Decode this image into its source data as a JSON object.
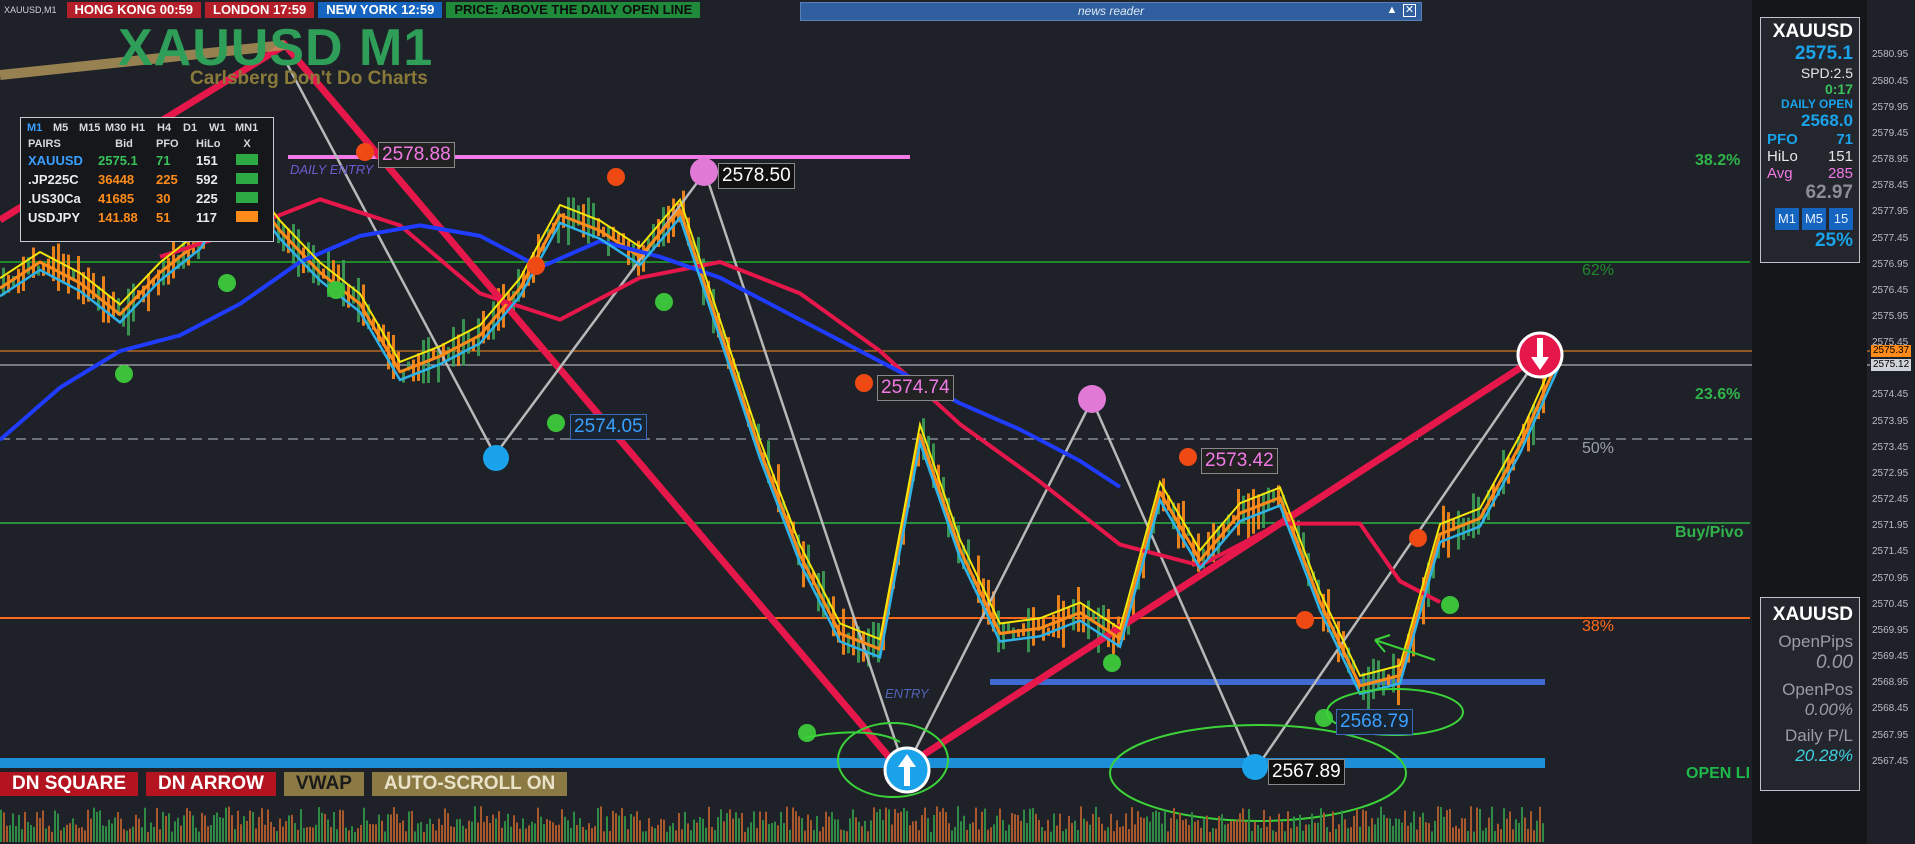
{
  "window": {
    "symbol_tab": "XAUUSD,M1"
  },
  "sessions": [
    {
      "label": "HONG KONG 00:59",
      "color": "#b51f2a"
    },
    {
      "label": "LONDON 17:59",
      "color": "#b51f2a"
    },
    {
      "label": "NEW YORK 12:59",
      "color": "#1565c0"
    },
    {
      "label": "PRICE: ABOVE THE DAILY OPEN LINE",
      "color": "#1e8a3a"
    }
  ],
  "news_reader": {
    "title": "news reader",
    "min_icon": "caret-up-icon",
    "close_icon": "close-icon"
  },
  "header": {
    "title": "XAUUSD M1",
    "subtitle": "Carlsberg Don't Do Charts"
  },
  "pairs_panel": {
    "timeframes": [
      "M1",
      "M5",
      "M15",
      "M30",
      "H1",
      "H4",
      "D1",
      "W1",
      "MN1"
    ],
    "columns": [
      "PAIRS",
      "Bid",
      "PFO",
      "HiLo",
      "X"
    ],
    "rows": [
      {
        "pair": "XAUUSD",
        "bid": "2575.1",
        "pfo": "71",
        "hilo": "151",
        "status_color": "#2eaa44",
        "pair_color": "#3aa0ff",
        "bid_color": "#39c15a"
      },
      {
        "pair": ".JP225C",
        "bid": "36448",
        "pfo": "225",
        "hilo": "592",
        "status_color": "#2eaa44",
        "pair_color": "#ffffff",
        "bid_color": "#ff8c1a"
      },
      {
        "pair": ".US30Ca",
        "bid": "41685",
        "pfo": "30",
        "hilo": "225",
        "status_color": "#2eaa44",
        "pair_color": "#ffffff",
        "bid_color": "#ff8c1a"
      },
      {
        "pair": "USDJPY",
        "bid": "141.88",
        "pfo": "51",
        "hilo": "117",
        "status_color": "#ff8c1a",
        "pair_color": "#ffffff",
        "bid_color": "#ff8c1a"
      }
    ]
  },
  "right_panel": {
    "symbol": "XAUUSD",
    "price": "2575.1",
    "spread": "SPD:2.5",
    "timer": "0:17",
    "daily_open_label": "DAILY OPEN",
    "daily_open": "2568.0",
    "pfo_label": "PFO",
    "pfo": "71",
    "hilo_label": "HiLo",
    "hilo": "151",
    "avg_label": "Avg",
    "avg": "285",
    "value": "62.97",
    "tf_buttons": [
      "M1",
      "M5",
      "15"
    ],
    "percent": "25%"
  },
  "position_panel": {
    "symbol": "XAUUSD",
    "open_pips_label": "OpenPips",
    "open_pips": "0.00",
    "open_pos_label": "OpenPos",
    "open_pos": "0.00%",
    "daily_pl_label": "Daily P/L",
    "daily_pl": "20.28%"
  },
  "bottom_buttons": [
    {
      "label": "DN SQUARE",
      "bg": "#b3141f",
      "fg": "#ffffff"
    },
    {
      "label": "DN ARROW",
      "bg": "#b3141f",
      "fg": "#ffffff"
    },
    {
      "label": "VWAP",
      "bg": "#8c7a45",
      "fg": "#1a1a1a"
    },
    {
      "label": "AUTO-SCROLL ON",
      "bg": "#8c7a45",
      "fg": "#e9e2c9"
    }
  ],
  "level_labels": {
    "fib_382": "38.2%",
    "fib_62": "62%",
    "fib_236": "23.6%",
    "fib_50": "50%",
    "buy_pivot": "Buy/Pivo",
    "fib_38": "38%",
    "open_line": "OPEN LI",
    "daily_entry": "DAILY ENTRY",
    "entry": "ENTRY"
  },
  "chart_data": {
    "type": "line",
    "symbol": "XAUUSD",
    "timeframe": "M1",
    "ylim": [
      2567.1,
      2580.9
    ],
    "y_ticks": [
      "2580.95",
      "2580.45",
      "2579.95",
      "2579.45",
      "2578.95",
      "2578.45",
      "2577.95",
      "2577.45",
      "2576.95",
      "2576.45",
      "2575.95",
      "2575.45",
      "2574.95",
      "2574.45",
      "2573.95",
      "2573.45",
      "2572.95",
      "2572.45",
      "2571.95",
      "2571.45",
      "2570.95",
      "2570.45",
      "2569.95",
      "2569.45",
      "2568.95",
      "2568.45",
      "2567.95",
      "2567.45"
    ],
    "current_price_labels": [
      "2575.37",
      "2575.12"
    ],
    "swing_price_labels": [
      {
        "price": "2578.88",
        "kind": "high"
      },
      {
        "price": "2578.50",
        "kind": "high"
      },
      {
        "price": "2574.05",
        "kind": "low"
      },
      {
        "price": "2574.74",
        "kind": "high"
      },
      {
        "price": "2573.42",
        "kind": "high"
      },
      {
        "price": "2568.79",
        "kind": "low"
      },
      {
        "price": "2567.89",
        "kind": "low"
      }
    ],
    "series": [
      {
        "color": "#ff8c1a",
        "x": [
          0,
          40,
          80,
          120,
          160,
          200,
          240,
          280,
          320,
          360,
          400,
          440,
          480,
          520,
          560,
          600,
          640,
          680,
          720,
          760,
          800,
          840,
          880,
          920,
          960,
          1000,
          1040,
          1080,
          1120,
          1160,
          1200,
          1240,
          1280,
          1320,
          1360,
          1400,
          1440,
          1480,
          1520,
          1560
        ],
        "y": [
          2576.5,
          2577.0,
          2576.6,
          2576.0,
          2576.8,
          2577.4,
          2578.6,
          2577.6,
          2576.8,
          2576.2,
          2574.9,
          2575.2,
          2575.6,
          2576.5,
          2577.9,
          2577.6,
          2577.1,
          2578.0,
          2575.7,
          2573.4,
          2571.4,
          2569.9,
          2569.6,
          2573.7,
          2571.5,
          2569.9,
          2570.0,
          2570.3,
          2569.8,
          2572.6,
          2571.3,
          2572.2,
          2572.5,
          2570.5,
          2568.9,
          2569.1,
          2571.8,
          2572.1,
          2573.5,
          2575.2
        ]
      },
      {
        "color": "#e6174a",
        "x": [
          160,
          240,
          320,
          400,
          480,
          560,
          640,
          720,
          800,
          880,
          960,
          1040,
          1120,
          1200,
          1280,
          1360,
          1400,
          1440
        ],
        "y": [
          2577.1,
          2577.6,
          2578.2,
          2577.7,
          2576.4,
          2575.9,
          2576.7,
          2577.0,
          2576.4,
          2575.3,
          2573.9,
          2572.8,
          2571.6,
          2571.2,
          2572.0,
          2572.0,
          2570.9,
          2570.5
        ]
      },
      {
        "color": "#1f3cff",
        "x": [
          0,
          60,
          120,
          180,
          240,
          300,
          360,
          420,
          480,
          540,
          600,
          660,
          720,
          780,
          840,
          900,
          960,
          1020,
          1080,
          1120
        ],
        "y": [
          2573.6,
          2574.6,
          2575.3,
          2575.6,
          2576.2,
          2577.0,
          2577.5,
          2577.7,
          2577.5,
          2576.9,
          2577.4,
          2577.1,
          2576.7,
          2576.1,
          2575.5,
          2574.9,
          2574.3,
          2573.8,
          2573.2,
          2572.7
        ]
      }
    ],
    "grid": false,
    "legend": "none"
  }
}
